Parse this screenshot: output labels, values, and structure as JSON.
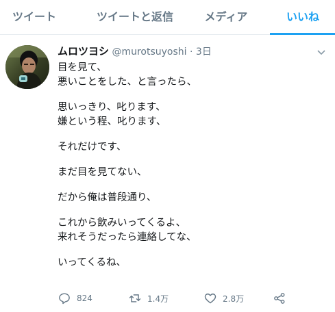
{
  "tabs": [
    {
      "label": "ツイート"
    },
    {
      "label": "ツイートと返信"
    },
    {
      "label": "メディア"
    },
    {
      "label": "いいね"
    }
  ],
  "tweet": {
    "name": "ムロツヨシ",
    "handle": "@murotsuyoshi",
    "dot": "·",
    "time": "3日",
    "lines": {
      "l1": "目を見て、",
      "l2": "悪いことをした、と言ったら、",
      "l3": "思いっきり、叱ります、",
      "l4": "嫌という程、叱ります、",
      "l5": "それだけです、",
      "l6": "まだ目を見てない、",
      "l7": "だから俺は普段通り、",
      "l8": "これから飲みいってくるよ、",
      "l9": "来れそうだったら連絡してな、",
      "l10": "いってくるね、"
    },
    "stats": {
      "replies": "824",
      "retweets": "1.4万",
      "likes": "2.8万"
    }
  },
  "colors": {
    "accent": "#1da1f2",
    "muted": "#657786",
    "text": "#14171a"
  },
  "icons": {
    "reply": "reply-icon",
    "retweet": "retweet-icon",
    "like": "heart-icon",
    "share": "share-icon",
    "menu": "chevron-down-icon"
  }
}
